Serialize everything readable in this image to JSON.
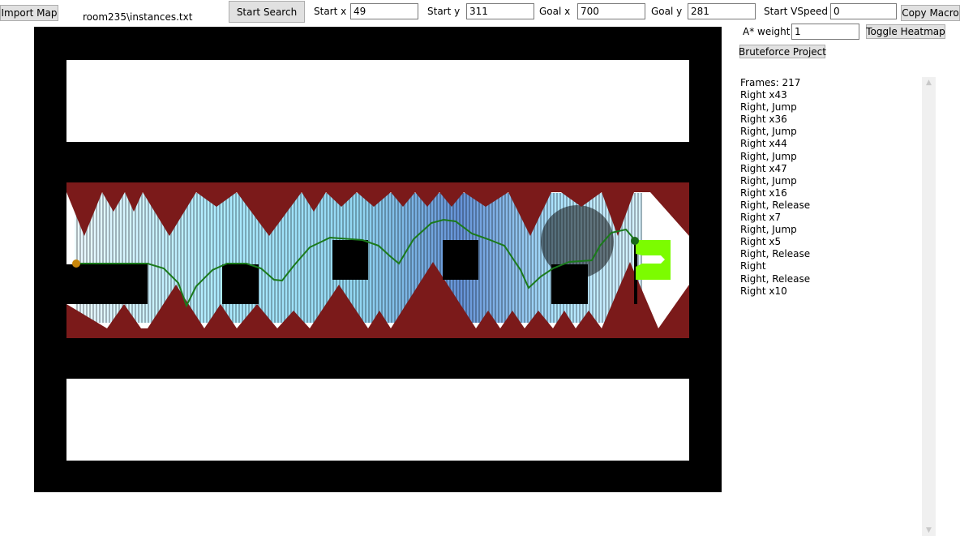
{
  "toolbar": {
    "import_map_label": "Import Map",
    "map_path": "room235\\instances.txt",
    "start_search_label": "Start Search",
    "start_x_label": "Start x",
    "start_x_value": "49",
    "start_y_label": "Start y",
    "start_y_value": "311",
    "goal_x_label": "Goal x",
    "goal_x_value": "700",
    "goal_y_label": "Goal y",
    "goal_y_value": "281",
    "start_vspeed_label": "Start VSpeed",
    "start_vspeed_value": "0",
    "copy_macro_label": "Copy Macro",
    "astar_weight_label": "A* weight",
    "astar_weight_value": "1",
    "toggle_heatmap_label": "Toggle Heatmap",
    "bruteforce_label": "Bruteforce Project"
  },
  "macro_output": [
    "Frames: 217",
    "Right x43",
    "Right, Jump",
    "Right x36",
    "Right, Jump",
    "Right x44",
    "Right, Jump",
    "Right x47",
    "Right, Jump",
    "Right x16",
    "Right, Release",
    "Right x7",
    "Right, Jump",
    "Right x5",
    "Right, Release",
    "Right",
    "Right, Release",
    "Right x10"
  ],
  "colors": {
    "wall": "#000000",
    "spike": "#7b1a1a",
    "path": "#1a7a1a",
    "start_marker": "#c8860b",
    "goal_marker": "#1a6a1a",
    "warp": "#7cfc00",
    "heatmap_light": "#9fe8ff",
    "heatmap_mid": "#4a7fd0"
  },
  "scrollbar_icons": {
    "up": "chevron-up-icon",
    "down": "chevron-down-icon"
  }
}
